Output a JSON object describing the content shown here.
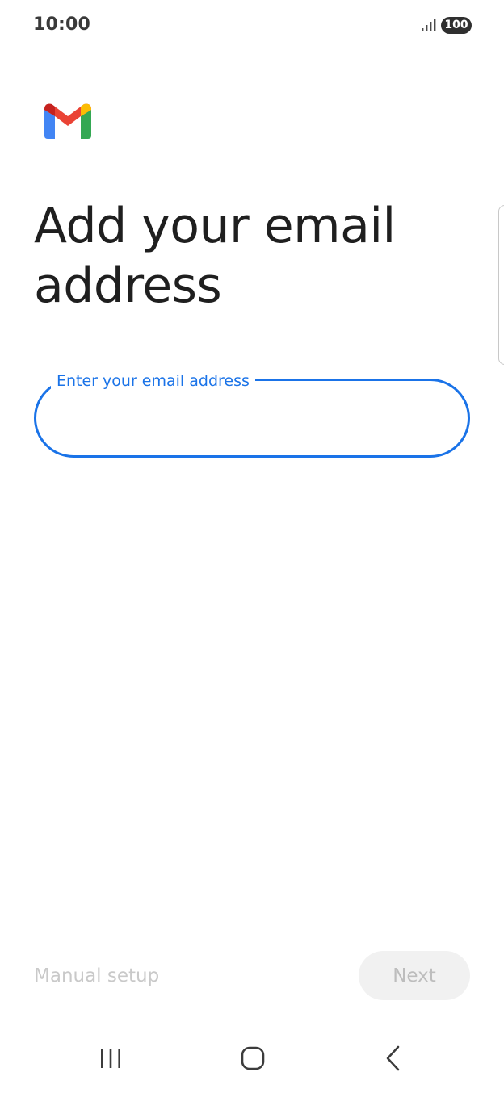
{
  "status_bar": {
    "time": "10:00",
    "battery": "100",
    "signal_icon": "signal-bars-icon"
  },
  "logo": {
    "name": "gmail-logo",
    "colors": {
      "blue": "#4285F4",
      "red": "#EA4335",
      "yellow": "#FBBC04",
      "green": "#34A853",
      "dark_red": "#C5221F"
    }
  },
  "main": {
    "title": "Add your email address",
    "email_field": {
      "label": "Enter your email address",
      "value": ""
    }
  },
  "footer": {
    "manual_setup_label": "Manual setup",
    "next_label": "Next"
  },
  "nav_bar": {
    "recents_icon": "recents-icon",
    "home_icon": "home-icon",
    "back_icon": "back-icon"
  },
  "colors": {
    "accent": "#1a73e8",
    "title_text": "#1f1f1f",
    "disabled_text": "#c9c9c9",
    "disabled_button_bg": "#f1f1f1"
  }
}
